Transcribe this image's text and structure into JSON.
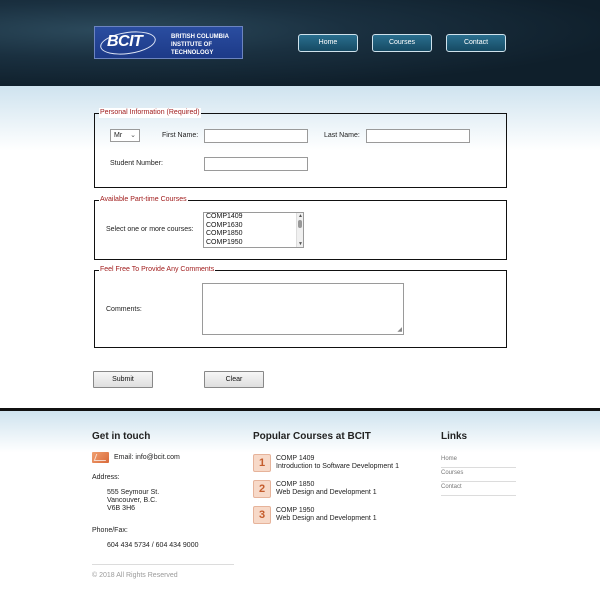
{
  "header": {
    "logo_mark": "BCIT",
    "logo_text_line1": "BRITISH COLUMBIA",
    "logo_text_line2": "INSTITUTE OF TECHNOLOGY",
    "nav": [
      {
        "label": "Home"
      },
      {
        "label": "Courses"
      },
      {
        "label": "Contact"
      }
    ]
  },
  "form": {
    "personal": {
      "legend": "Personal Information (Required)",
      "title_select": "Mr",
      "first_name_label": "First Name:",
      "last_name_label": "Last Name:",
      "student_number_label": "Student Number:",
      "first_name_value": "",
      "last_name_value": "",
      "student_number_value": ""
    },
    "courses": {
      "legend": "Available Part-time Courses",
      "select_label": "Select one or more courses:",
      "options": [
        "COMP1409",
        "COMP1630",
        "COMP1850",
        "COMP1950"
      ]
    },
    "comments": {
      "legend": "Feel Free To Provide Any Comments",
      "label": "Comments:",
      "value": ""
    },
    "submit_label": "Submit",
    "clear_label": "Clear"
  },
  "footer": {
    "get_in_touch": {
      "heading": "Get in touch",
      "email": "Email: info@bcit.com",
      "address_label": "Address:",
      "address_lines": [
        "555 Seymour St.",
        "Vancouver, B.C.",
        "V6B 3H6"
      ],
      "phone_label": "Phone/Fax:",
      "phone": "604 434 5734 / 604 434 9000"
    },
    "popular": {
      "heading": "Popular Courses at BCIT",
      "items": [
        {
          "num": "1",
          "code": "COMP 1409",
          "title": "Introduction to Software Development 1"
        },
        {
          "num": "2",
          "code": "COMP 1850",
          "title": "Web Design and Development 1"
        },
        {
          "num": "3",
          "code": "COMP 1950",
          "title": "Web Design and Development 1"
        }
      ]
    },
    "links": {
      "heading": "Links",
      "items": [
        "Home",
        "Courses",
        "Contact"
      ]
    },
    "copyright": "© 2018 All Rights Reserved"
  }
}
